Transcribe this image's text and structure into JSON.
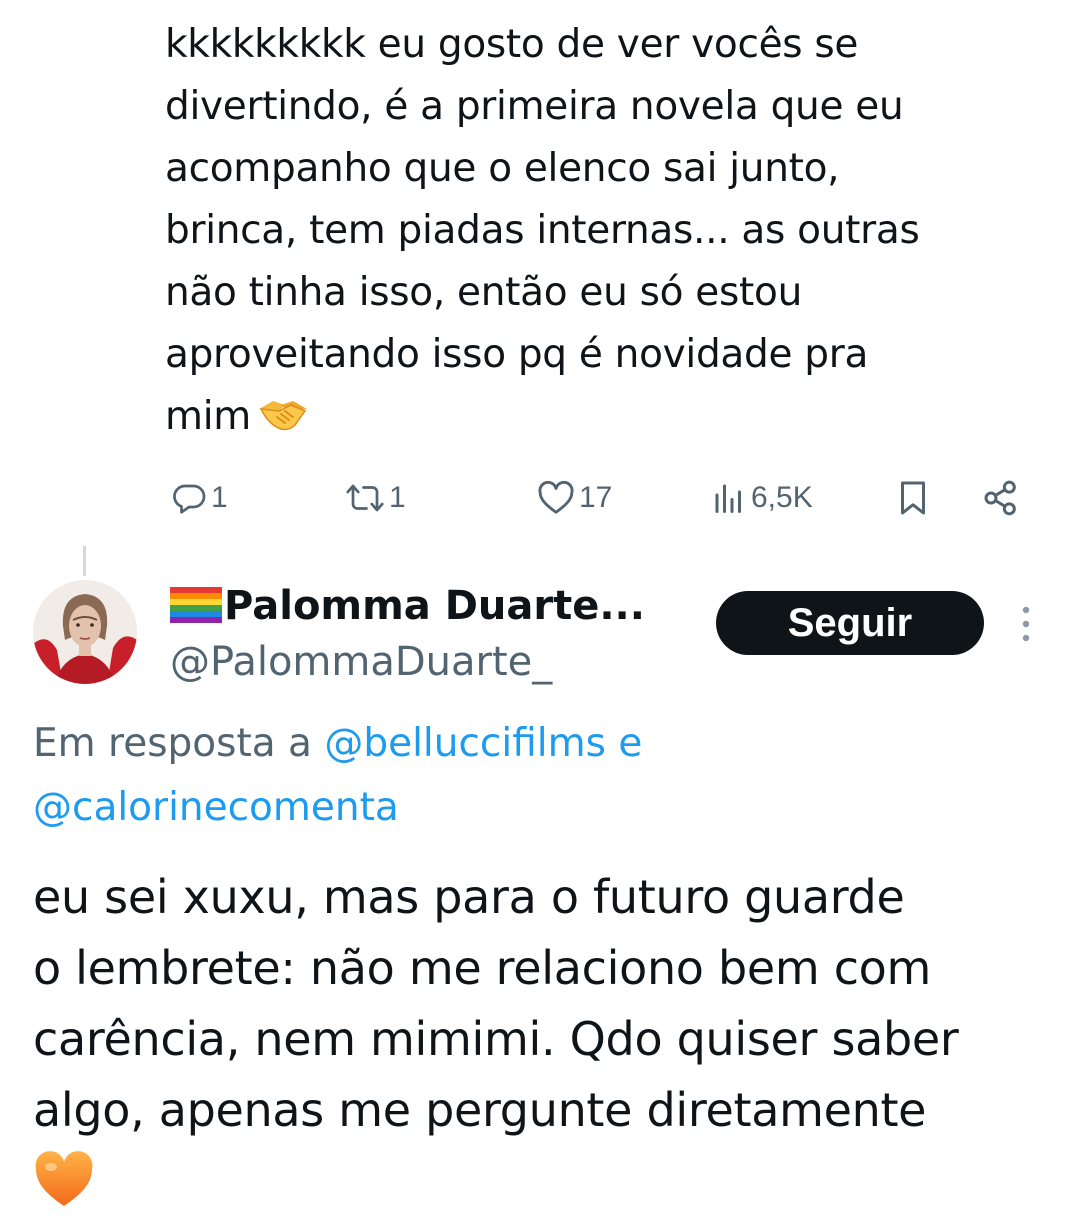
{
  "parent_tweet": {
    "text": "kkkkkkkkk eu gosto de ver vocês se\ndivertindo, é a primeira novela que eu\nacompanho que o elenco sai junto,\nbrinca, tem piadas internas... as outras\nnão tinha isso, então eu só estou\naproveitando isso pq é novidade pra\nmim",
    "trailing_emoji": "handshake-emoji",
    "actions": {
      "replies": "1",
      "retweets": "1",
      "likes": "17",
      "views": "6,5K"
    }
  },
  "tweet": {
    "author_name": "Palomma Duarte...",
    "author_name_prefix_emoji": "rainbow-flag-emoji",
    "author_handle": "@PalommaDuarte_",
    "follow_label": "Seguir",
    "reply_context": {
      "prefix": "Em resposta a ",
      "mention_1": "@belluccifilms",
      "connector": " e",
      "mention_2": "@calorinecomenta"
    },
    "text": "eu sei xuxu, mas para o futuro guarde\no lembrete: não me relaciono bem com\ncarência, nem mimimi. Qdo quiser saber\nalgo, apenas me pergunte diretamente",
    "trailing_emoji": "orange-heart-emoji"
  },
  "colors": {
    "text_primary": "#0f1419",
    "text_secondary": "#536471",
    "link": "#1d9bf0",
    "follow_button_bg": "#0f1419",
    "divider": "#cfd9de"
  }
}
